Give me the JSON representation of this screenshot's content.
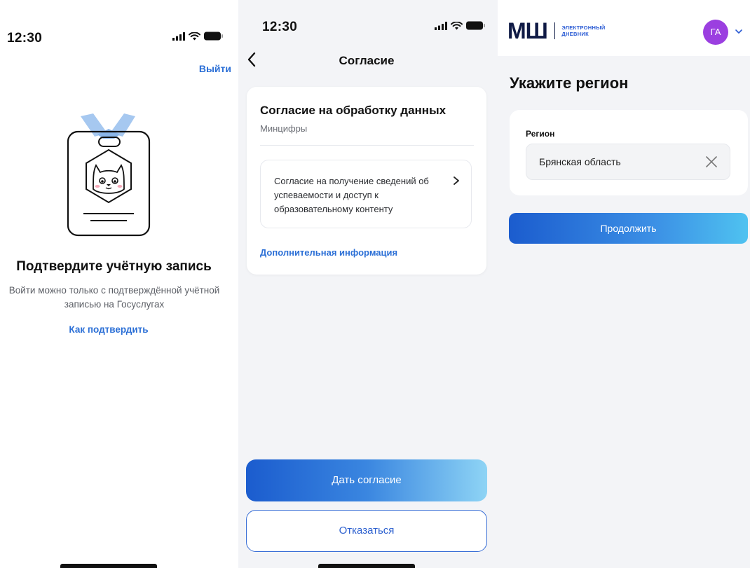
{
  "colors": {
    "accent_blue": "#2b6fd6",
    "avatar_purple": "#9b3fe0",
    "logo_navy": "#0f1a45",
    "screen_gray": "#f3f4f7"
  },
  "screen_confirm": {
    "status_time": "12:30",
    "logout_label": "Выйти",
    "illustration_icon": "id-badge-cat-icon",
    "title": "Подтвердите учётную запись",
    "description": "Войти можно только с подтверждённой учётной записью на Госуслугах",
    "how_to_confirm_link": "Как подтвердить"
  },
  "screen_consent": {
    "status_time": "12:30",
    "back_icon": "chevron-left-icon",
    "nav_title": "Согласие",
    "card_title": "Согласие на обработку данных",
    "card_org": "Минцифры",
    "consent_item_text": "Согласие на получение сведений об успеваемости и доступ к образовательному контенту",
    "more_info_link": "Дополнительная информация",
    "agree_label": "Дать согласие",
    "decline_label": "Отказаться"
  },
  "screen_region": {
    "logo_mark": "МШ",
    "logo_sub_line1": "ЭЛЕКТРОННЫЙ",
    "logo_sub_line2": "ДНЕВНИК",
    "avatar_initials": "ГА",
    "page_title": "Укажите регион",
    "region_label": "Регион",
    "region_value": "Брянская область",
    "continue_label": "Продолжить"
  }
}
